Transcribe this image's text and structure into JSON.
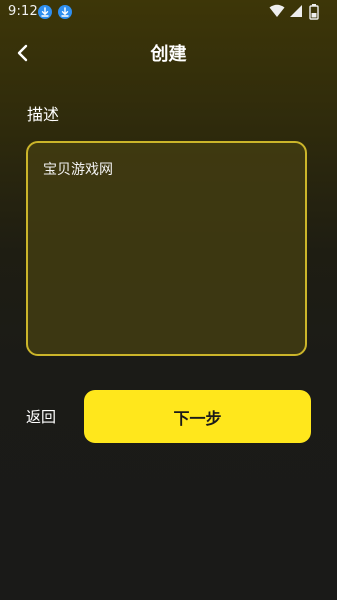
{
  "status_bar": {
    "time": "9:12",
    "icons": [
      "download-icon",
      "download-icon",
      "wifi-icon",
      "signal-icon",
      "battery-icon"
    ],
    "accent_color": "#2f8ff0"
  },
  "header": {
    "title": "创建",
    "back_icon": "chevron-left-icon"
  },
  "form": {
    "description_label": "描述",
    "description_value": "宝贝游戏网"
  },
  "actions": {
    "return_label": "返回",
    "next_label": "下一步",
    "next_color": "#ffe71c"
  },
  "colors": {
    "box_border": "#cbb52a",
    "background_top": "#3d3608",
    "background_bottom": "#1a1a18"
  }
}
